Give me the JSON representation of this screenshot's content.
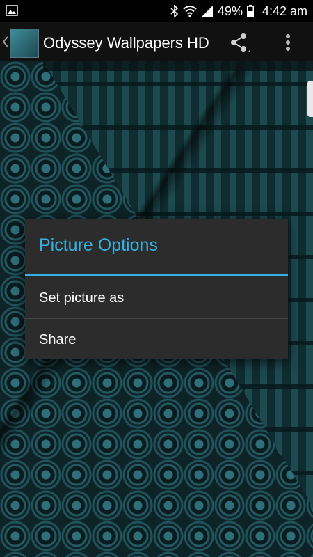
{
  "status_bar": {
    "battery_percent": "49%",
    "time": "4:42 am",
    "icons": [
      "gallery-notification-icon",
      "bluetooth-icon",
      "wifi-icon",
      "signal-icon",
      "battery-icon"
    ]
  },
  "action_bar": {
    "title": "Odyssey Wallpapers HD",
    "icons": [
      "back-chevron-icon",
      "app-logo-icon",
      "share-icon",
      "overflow-menu-icon"
    ]
  },
  "dialog": {
    "title": "Picture Options",
    "options": [
      {
        "label": "Set picture as"
      },
      {
        "label": "Share"
      }
    ],
    "accent_color": "#37b1e4"
  },
  "colors": {
    "dialog_bg": "#2c2c2c",
    "action_bar_bg": "#111111",
    "status_bar_bg": "#000000",
    "wallpaper_teal": "#1d4a4f"
  }
}
